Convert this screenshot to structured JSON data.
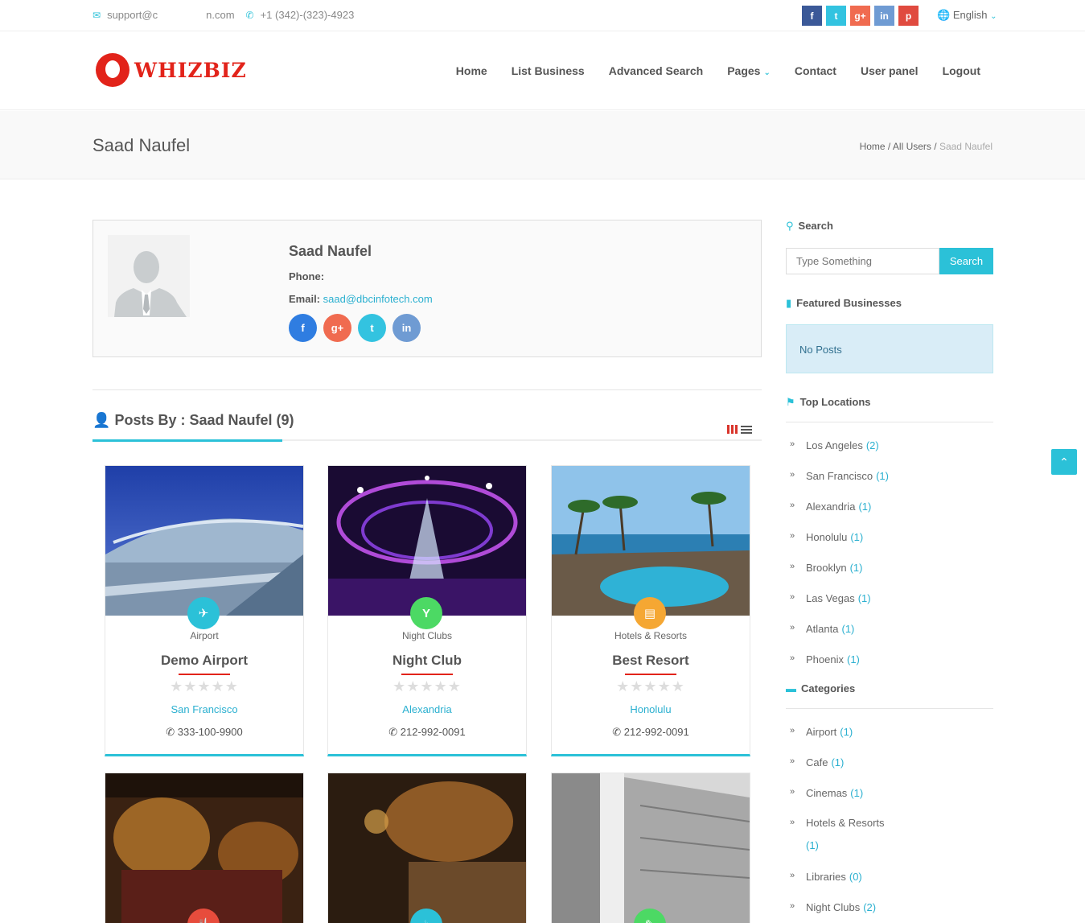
{
  "topbar": {
    "email_prefix": "support@c",
    "email_suffix": "n.com",
    "phone": "+1 (342)-(323)-4923",
    "socials": [
      {
        "name": "facebook",
        "glyph": "f",
        "color": "#3b5998"
      },
      {
        "name": "twitter",
        "glyph": "t",
        "color": "#33c3e0"
      },
      {
        "name": "google-plus",
        "glyph": "g+",
        "color": "#f06b50"
      },
      {
        "name": "linkedin",
        "glyph": "in",
        "color": "#6f9bd3"
      },
      {
        "name": "pinterest",
        "glyph": "p",
        "color": "#e04a3f"
      }
    ],
    "language": "English"
  },
  "header": {
    "logo_text": "WHIZBIZ",
    "nav": [
      "Home",
      "List Business",
      "Advanced Search",
      "Pages",
      "Contact",
      "User panel",
      "Logout"
    ]
  },
  "titleband": {
    "title": "Saad Naufel",
    "crumbs": [
      "Home",
      "All Users",
      "Saad Naufel"
    ]
  },
  "profile": {
    "name": "Saad Naufel",
    "phone_label": "Phone:",
    "email_label": "Email:",
    "email": "saad@dbcinfotech.com",
    "socials": [
      {
        "name": "facebook",
        "glyph": "f",
        "color": "#2f7de1"
      },
      {
        "name": "google-plus",
        "glyph": "g+",
        "color": "#f06b50"
      },
      {
        "name": "twitter",
        "glyph": "t",
        "color": "#33c3e0"
      },
      {
        "name": "linkedin",
        "glyph": "in",
        "color": "#6f9bd3"
      }
    ]
  },
  "posts": {
    "heading": "Posts By : Saad Naufel (9)",
    "cards": [
      {
        "category": "Airport",
        "title": "Demo Airport",
        "location": "San Francisco",
        "phone": "333-100-9900",
        "icon": "plane-icon",
        "glyph": "✈",
        "icon_color": "#2bc1d8",
        "stars": "★★★★★"
      },
      {
        "category": "Night Clubs",
        "title": "Night Club",
        "location": "Alexandria",
        "phone": "212-992-0091",
        "icon": "cocktail-icon",
        "glyph": "Y",
        "icon_color": "#4cd964",
        "stars": "★★★★★"
      },
      {
        "category": "Hotels & Resorts",
        "title": "Best Resort",
        "location": "Honolulu",
        "phone": "212-992-0091",
        "icon": "building-icon",
        "glyph": "▤",
        "icon_color": "#f5a733",
        "stars": "★★★★★"
      },
      {
        "icon": "restaurant-icon",
        "glyph": "🍴",
        "icon_color": "#e74c3c"
      },
      {
        "icon": "coffee-icon",
        "glyph": "☕",
        "icon_color": "#2bc1d8"
      },
      {
        "icon": "ticket-icon",
        "glyph": "✎",
        "icon_color": "#4cd964"
      }
    ]
  },
  "sidebar": {
    "search_title": "Search",
    "search_placeholder": "Type Something",
    "search_button": "Search",
    "featured_title": "Featured Businesses",
    "no_posts": "No Posts",
    "locations_title": "Top Locations",
    "locations": [
      {
        "name": "Los Angeles",
        "count": "(2)"
      },
      {
        "name": "San Francisco",
        "count": "(1)"
      },
      {
        "name": "Alexandria",
        "count": "(1)"
      },
      {
        "name": "Honolulu",
        "count": "(1)"
      },
      {
        "name": "Brooklyn",
        "count": "(1)"
      },
      {
        "name": "Las Vegas",
        "count": "(1)"
      },
      {
        "name": "Atlanta",
        "count": "(1)"
      },
      {
        "name": "Phoenix",
        "count": "(1)"
      }
    ],
    "categories_title": "Categories",
    "categories": [
      {
        "name": "Airport",
        "count": "(1)"
      },
      {
        "name": "Cafe",
        "count": "(1)"
      },
      {
        "name": "Cinemas",
        "count": "(1)"
      },
      {
        "name": "Hotels & Resorts",
        "count": "(1)"
      },
      {
        "name": "Libraries",
        "count": "(0)"
      },
      {
        "name": "Night Clubs",
        "count": "(2)"
      }
    ]
  },
  "colors": {
    "accent": "#2bc1d8",
    "brand": "#e2231a"
  }
}
